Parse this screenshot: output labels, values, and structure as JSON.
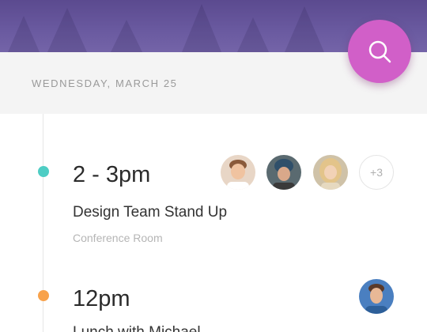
{
  "header": {
    "date_label": "WEDNESDAY, MARCH 25",
    "search_icon": "search-icon"
  },
  "events": [
    {
      "time": "2 - 3pm",
      "title": "Design Team Stand Up",
      "location": "Conference Room",
      "dot_color": "#4ecdc4",
      "attendees": [
        "avatar",
        "avatar",
        "avatar"
      ],
      "more_count": "+3"
    },
    {
      "time": "12pm",
      "title": "Lunch with Michael",
      "dot_color": "#f8a24b",
      "attendees": [
        "avatar"
      ]
    }
  ],
  "colors": {
    "header": "#6a5aa0",
    "fab": "#d15fc8",
    "teal": "#4ecdc4",
    "orange": "#f8a24b"
  }
}
